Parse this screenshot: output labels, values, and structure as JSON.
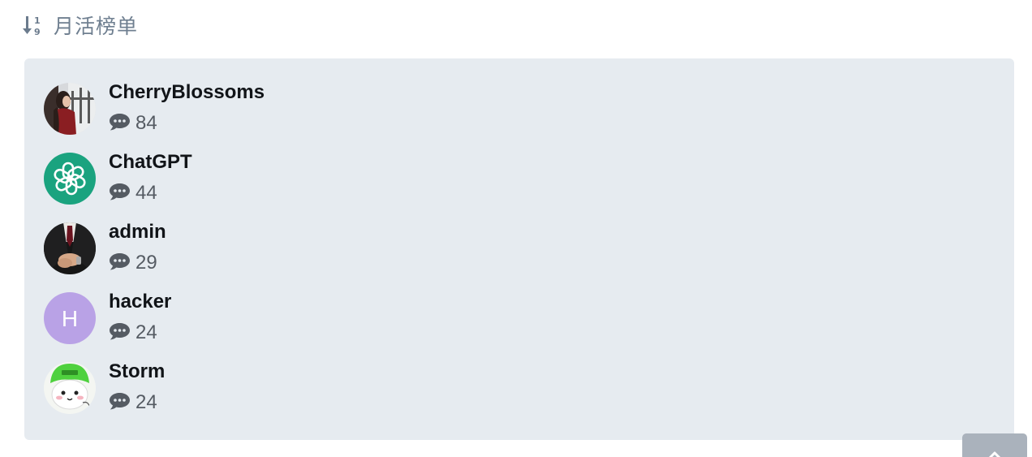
{
  "header": {
    "icon": "sort-numeric-down-icon",
    "title": "月活榜单"
  },
  "leaderboard": {
    "items": [
      {
        "username": "CherryBlossoms",
        "count": "84",
        "avatar": "photo-woman-window"
      },
      {
        "username": "ChatGPT",
        "count": "44",
        "avatar": "openai-logo"
      },
      {
        "username": "admin",
        "count": "29",
        "avatar": "photo-suit-hands"
      },
      {
        "username": "hacker",
        "count": "24",
        "avatar": "letter-avatar",
        "avatar_letter": "H",
        "avatar_color": "#b9a2e6"
      },
      {
        "username": "Storm",
        "count": "24",
        "avatar": "cartoon-green-hat"
      }
    ]
  },
  "colors": {
    "card_bg": "#e6ebf0",
    "header_text": "#6f7f90",
    "chatgpt_green": "#1aa37f",
    "back_to_top": "#aab2bc"
  },
  "back_to_top": {
    "icon": "chevron-up-icon"
  }
}
